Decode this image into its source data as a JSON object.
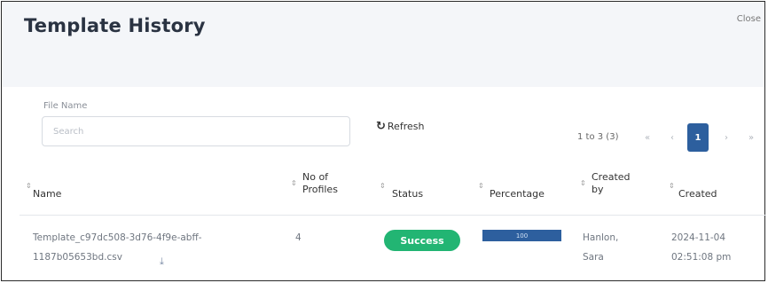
{
  "header": {
    "title": "Template History",
    "close_label": "Close"
  },
  "filters": {
    "file_name_label": "File Name",
    "search_placeholder": "Search",
    "search_value": "",
    "refresh_label": "Refresh"
  },
  "pagination": {
    "info": "1 to 3 (3)",
    "first": "«",
    "prev": "‹",
    "current": "1",
    "next": "›",
    "last": "»"
  },
  "table": {
    "columns": {
      "name": "Name",
      "profiles_line1": "No of",
      "profiles_line2": "Profiles",
      "status": "Status",
      "percentage": "Percentage",
      "created_by_line1": "Created",
      "created_by_line2": "by",
      "created": "Created"
    },
    "row": {
      "name_line1": "Template_c97dc508-3d76-4f9e-abff-",
      "name_line2": "1187b05653bd.csv",
      "profiles": "4",
      "status": "Success",
      "percentage": "100",
      "created_by_line1": "Hanlon,",
      "created_by_line2": "Sara",
      "created_line1": "2024-11-04",
      "created_line2": "02:51:08 pm"
    }
  },
  "colors": {
    "accent": "#2d5f9e",
    "success": "#22b573",
    "header_bg": "#f4f6f9"
  },
  "icons": {
    "refresh": "refresh-icon",
    "sort": "sort-icon",
    "download": "download-icon"
  }
}
